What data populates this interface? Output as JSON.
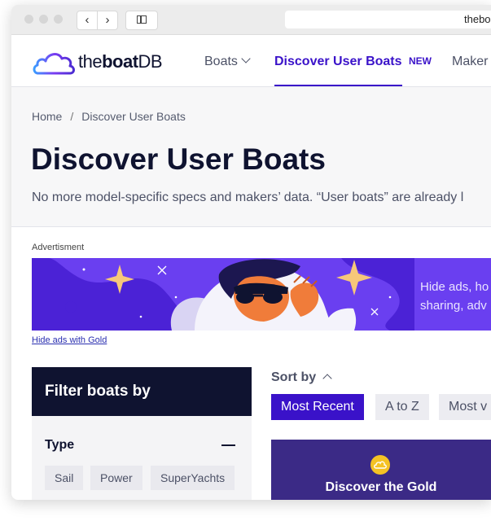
{
  "browser": {
    "url": "thebo"
  },
  "header": {
    "logo_part1": "the",
    "logo_part2": "boat",
    "logo_part3": "DB",
    "nav": {
      "boats": "Boats",
      "discover": "Discover User Boats",
      "new_badge": "NEW",
      "makers": "Maker"
    }
  },
  "hero": {
    "breadcrumb_home": "Home",
    "breadcrumb_sep": "/",
    "breadcrumb_current": "Discover User Boats",
    "title": "Discover User Boats",
    "subtitle": "No more model-specific specs and makers’ data. “User boats” are already l"
  },
  "ad": {
    "label": "Advertisment",
    "text_line1": "Hide ads, ho",
    "text_line2": "sharing, adv",
    "hide_link": "Hide ads with Gold"
  },
  "filter": {
    "title": "Filter boats by",
    "type_label": "Type",
    "chips": [
      "Sail",
      "Power",
      "SuperYachts"
    ]
  },
  "sort": {
    "label": "Sort by",
    "options": [
      "Most Recent",
      "A to Z",
      "Most v"
    ],
    "active": "Most Recent"
  },
  "gold_card": {
    "text": "Discover the Gold"
  },
  "colors": {
    "accent": "#3a12c9",
    "navy": "#0f1330",
    "ad_purple": "#6a3ff0",
    "gold": "#f4c224"
  }
}
